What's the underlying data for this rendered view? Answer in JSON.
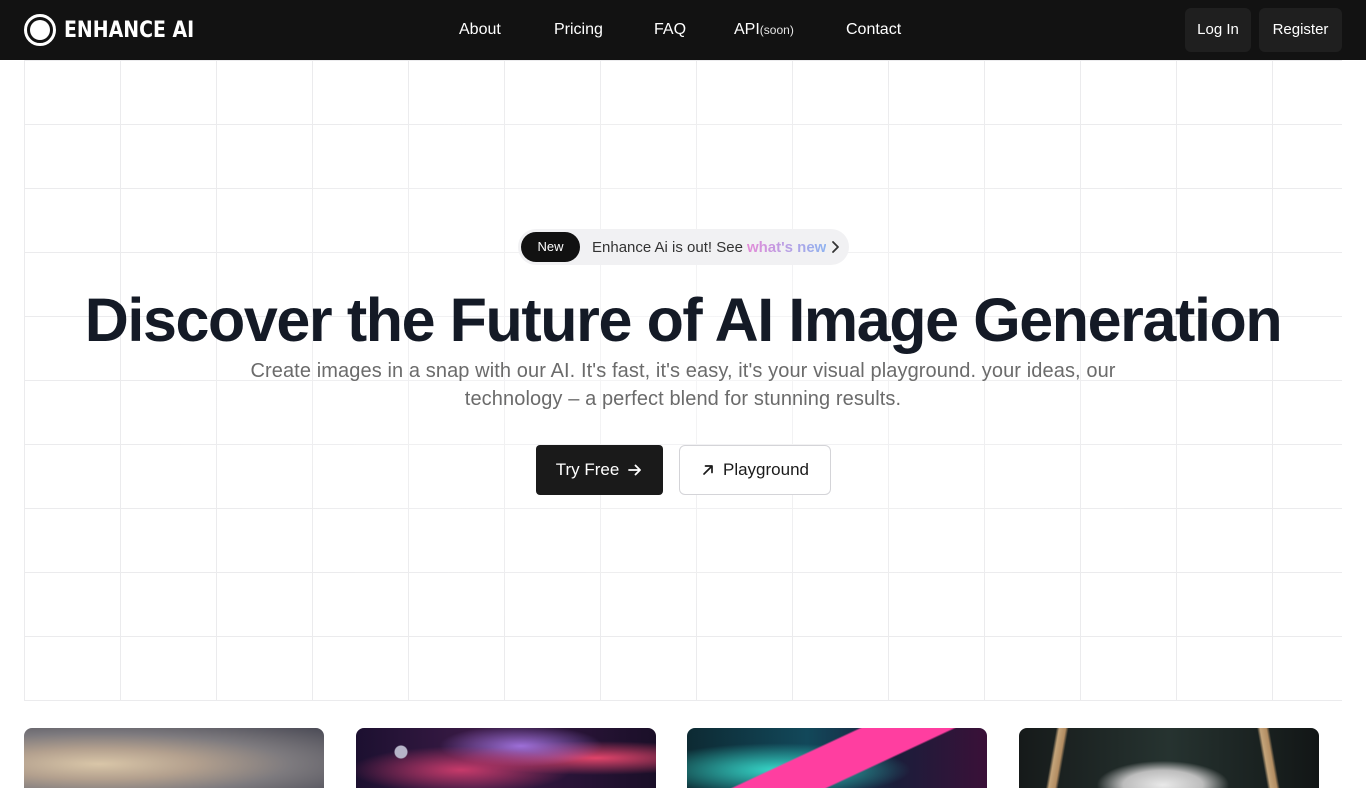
{
  "brand": {
    "name": "ENHANCE AI"
  },
  "nav": {
    "about": "About",
    "pricing": "Pricing",
    "faq": "FAQ",
    "api": "API",
    "api_tag": "(soon)",
    "contact": "Contact"
  },
  "auth": {
    "login": "Log In",
    "register": "Register"
  },
  "announcement": {
    "badge": "New",
    "text": "Enhance Ai is out! See",
    "link": "what's new"
  },
  "hero": {
    "title": "Discover the Future of AI Image Generation",
    "subtitle": "Create images in a snap with our AI. It's fast, it's easy, it's your visual playground. your ideas, our technology – a perfect blend for stunning results."
  },
  "cta": {
    "primary": "Try Free",
    "secondary": "Playground"
  },
  "colors": {
    "topbar": "#121212",
    "title": "#141a26",
    "subtitle": "#6b6b6b",
    "primary_button": "#1a1a1a",
    "link_gradient_start": "#e38bd8",
    "link_gradient_end": "#8fb3f0"
  },
  "icons": {
    "logo": "ring-logo-icon",
    "chevron": "chevron-right-icon",
    "arrow": "arrow-right-icon",
    "external": "arrow-up-right-icon"
  }
}
